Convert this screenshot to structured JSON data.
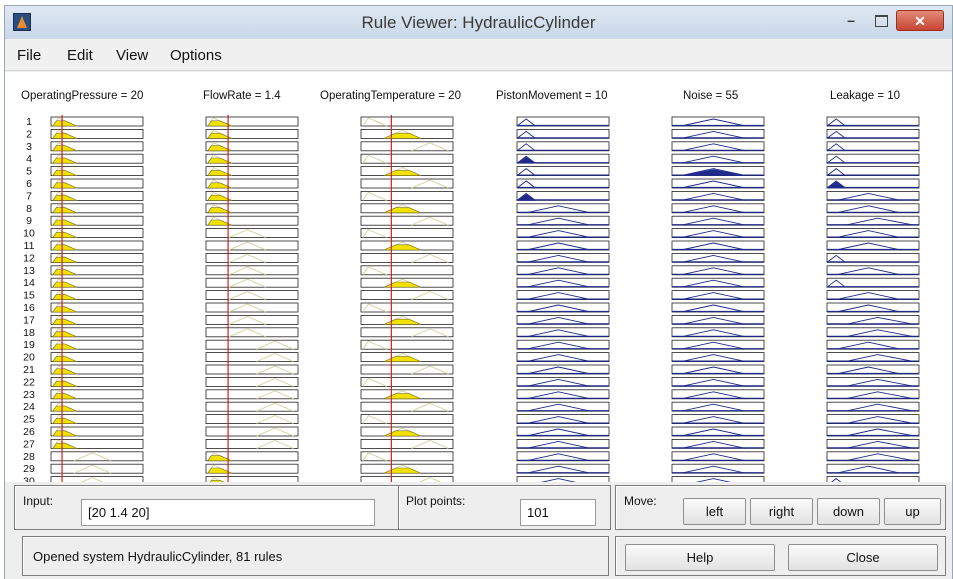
{
  "window": {
    "title": "Rule Viewer: HydraulicCylinder",
    "minimize_glyph": "–",
    "close_glyph": "✕"
  },
  "menu": [
    {
      "label": "File"
    },
    {
      "label": "Edit"
    },
    {
      "label": "View"
    },
    {
      "label": "Options"
    }
  ],
  "variables": [
    {
      "label": "OperatingPressure = 20",
      "kind": "input",
      "value": 20
    },
    {
      "label": "FlowRate = 1.4",
      "kind": "input",
      "value": 1.4
    },
    {
      "label": "OperatingTemperature = 20",
      "kind": "input",
      "value": 20
    },
    {
      "label": "PistonMovement = 10",
      "kind": "output",
      "value": 10
    },
    {
      "label": "Noise = 55",
      "kind": "output",
      "value": 55
    },
    {
      "label": "Leakage = 10",
      "kind": "output",
      "value": 10
    }
  ],
  "rule_numbers": [
    "1",
    "2",
    "3",
    "4",
    "5",
    "6",
    "7",
    "8",
    "9",
    "10",
    "11",
    "12",
    "13",
    "14",
    "15",
    "16",
    "17",
    "18",
    "19",
    "20",
    "21",
    "22",
    "23",
    "24",
    "25",
    "26",
    "27",
    "28",
    "29",
    "30"
  ],
  "controls": {
    "input_label": "Input:",
    "input_value": "[20 1.4 20]",
    "plot_points_label": "Plot points:",
    "plot_points_value": "101",
    "move_label": "Move:",
    "left_label": "left",
    "right_label": "right",
    "down_label": "down",
    "up_label": "up",
    "help_label": "Help",
    "close_label": "Close"
  },
  "status_text": "Opened system HydraulicCylinder, 81 rules",
  "colors": {
    "fired_fill": "#f2e200",
    "unfired_mf": "#d8d4a8",
    "output_mf": "#1f2a8a",
    "index_line": "#d42020",
    "close_button": "#c74431"
  }
}
